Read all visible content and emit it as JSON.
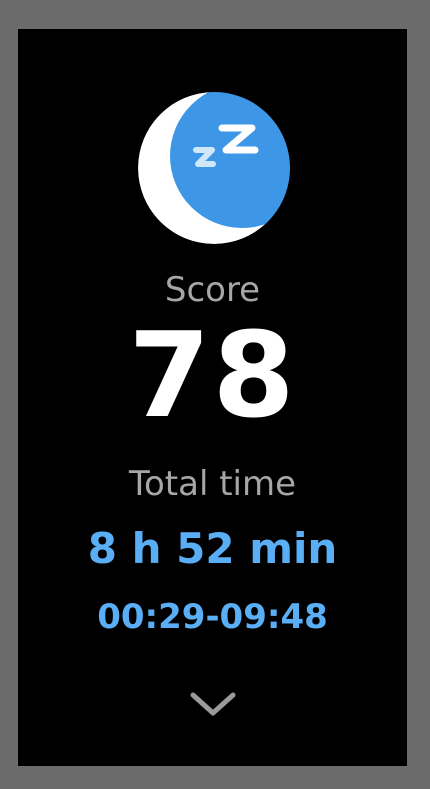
{
  "sleep": {
    "score_label": "Score",
    "score_value": "78",
    "total_label": "Total time",
    "total_value": "8 h 52 min",
    "time_range": "00:29-09:48"
  },
  "icons": {
    "main": "moon-sleep-icon",
    "more": "chevron-down-icon"
  },
  "colors": {
    "accent": "#5aaef5",
    "moon": "#3d97e6",
    "label": "#a6a6a6",
    "background": "#000000",
    "bezel": "#6b6b6b"
  }
}
